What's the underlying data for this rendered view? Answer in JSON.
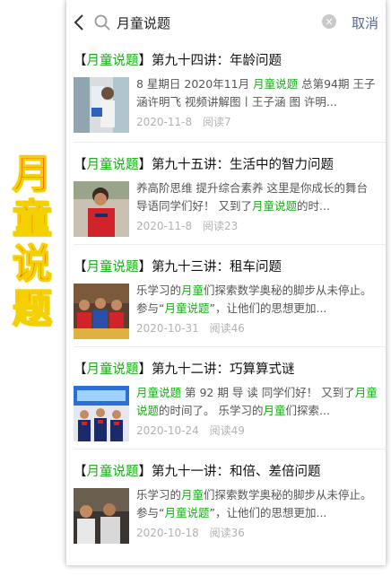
{
  "side_title": [
    "月",
    "童",
    "说",
    "题"
  ],
  "search": {
    "query": "月童说题",
    "cancel_label": "取消"
  },
  "results": [
    {
      "tag": "月童说题",
      "title": "第九十四讲：年龄问题",
      "snippet_parts": [
        {
          "text": "8 星期日 2020年11月 ",
          "hl": false
        },
        {
          "text": "月童说题",
          "hl": true
        },
        {
          "text": " 总第94期 王子涵许明飞 视频讲解图丨王子涵 图  许明...",
          "hl": false
        }
      ],
      "date": "2020-11-8",
      "reads": "阅读7"
    },
    {
      "tag": "月童说题",
      "title": "第九十五讲：生活中的智力问题",
      "snippet_parts": [
        {
          "text": "养高阶思维 提升综合素养 这里是你成长的舞台 导语同学们好！ 又到了",
          "hl": false
        },
        {
          "text": "月童说题",
          "hl": true
        },
        {
          "text": "的时...",
          "hl": false
        }
      ],
      "date": "2020-11-8",
      "reads": "阅读23"
    },
    {
      "tag": "月童说题",
      "title": "第九十三讲：租车问题",
      "snippet_parts": [
        {
          "text": "乐学习的",
          "hl": false
        },
        {
          "text": "月童",
          "hl": true
        },
        {
          "text": "们探索数学奥秘的脚步从未停止。 参与“",
          "hl": false
        },
        {
          "text": "月童说题",
          "hl": true
        },
        {
          "text": "”，让他们的思想更加...",
          "hl": false
        }
      ],
      "date": "2020-10-31",
      "reads": "阅读46"
    },
    {
      "tag": "月童说题",
      "title": "第九十二讲：巧算算式谜",
      "snippet_parts": [
        {
          "text": "月童说题",
          "hl": true
        },
        {
          "text": " 第 92 期 导 读 同学们好！ 又到了",
          "hl": false
        },
        {
          "text": "月童说题",
          "hl": true
        },
        {
          "text": "的时间了。 乐学习的",
          "hl": false
        },
        {
          "text": "月童",
          "hl": true
        },
        {
          "text": "们探索...",
          "hl": false
        }
      ],
      "date": "2020-10-24",
      "reads": "阅读49"
    },
    {
      "tag": "月童说题",
      "title": "第九十一讲：和倍、差倍问题",
      "snippet_parts": [
        {
          "text": "乐学习的",
          "hl": false
        },
        {
          "text": "月童",
          "hl": true
        },
        {
          "text": "们探索数学奥秘的脚步从未停止。 参与“",
          "hl": false
        },
        {
          "text": "月童说题",
          "hl": true
        },
        {
          "text": "”，让他们的思想更加...",
          "hl": false
        }
      ],
      "date": "2020-10-18",
      "reads": "阅读36"
    }
  ],
  "colors": {
    "highlight": "#1aad19",
    "side_title": "#ff2a1a",
    "side_title_outline": "#f4d000",
    "cancel": "#576b95"
  }
}
